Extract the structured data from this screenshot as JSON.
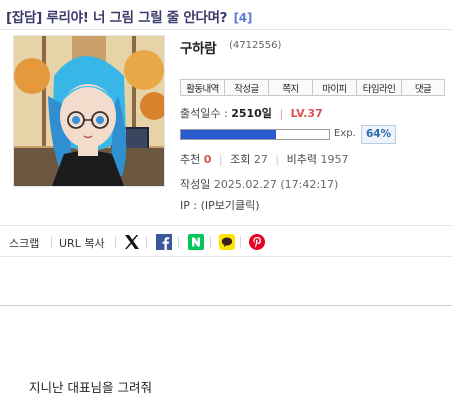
{
  "post": {
    "category": "[잡담]",
    "title": "루리야! 너 그림 그릴 줄 안다며?",
    "comment_count": "[4]",
    "body": "지니난 대표님을 그려줘"
  },
  "author": {
    "nickname": "구하람",
    "member_no": "(4712556)",
    "menu": [
      "활동내역",
      "작성글",
      "쪽지",
      "마이피",
      "타임라인",
      "댓글"
    ],
    "attend_label": "출석일수 :",
    "attend_value": "2510일",
    "level": "LV.37",
    "exp_label": "Exp.",
    "exp_percent": "64%",
    "exp_fraction": 0.64
  },
  "stats": {
    "recommend_label": "추천",
    "recommend_value": "0",
    "views_label": "조회",
    "views_value": "27",
    "nonrec_label": "비추력",
    "nonrec_value": "1957"
  },
  "meta": {
    "date_label": "작성일",
    "date_value": "2025.02.27 (17:42:17)",
    "ip_label": "IP :",
    "ip_value": "(IP보기클릭)"
  },
  "share": {
    "scrap": "스크랩",
    "copy_url": "URL 복사",
    "icons": [
      "x-icon",
      "facebook-icon",
      "naver-icon",
      "kakaotalk-icon",
      "pinterest-icon"
    ]
  },
  "colors": {
    "accent_blue": "#2a5bd0",
    "level_red": "#d9534f",
    "facebook": "#3b5998",
    "naver": "#03c75a",
    "kakao": "#fee500",
    "pinterest": "#e60023"
  }
}
